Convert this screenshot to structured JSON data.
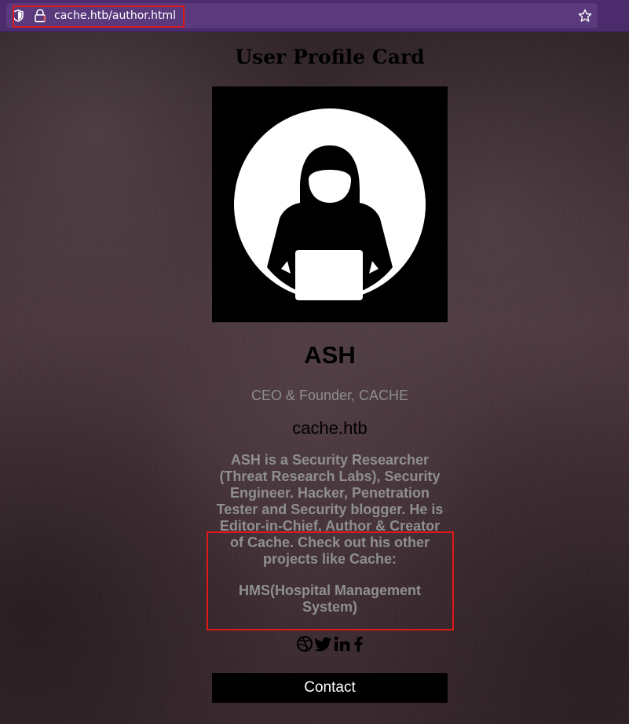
{
  "browser": {
    "url": "cache.htb/author.html"
  },
  "page": {
    "title": "User Profile Card"
  },
  "profile": {
    "name": "ASH",
    "role": "CEO & Founder, CACHE",
    "website": "cache.htb",
    "bio": "ASH is a Security Researcher (Threat Research Labs), Security Engineer. Hacker, Penetration Tester and Security blogger. He is Editor-in-Chief, Author & Creator of Cache. Check out his other projects like Cache:",
    "projects": "HMS(Hospital Management System)",
    "contact_label": "Contact"
  },
  "social": {
    "icons": [
      "dribbble-icon",
      "twitter-icon",
      "linkedin-icon",
      "facebook-icon"
    ]
  },
  "colors": {
    "browser_bar": "#4b2b6b",
    "highlight": "#e01818",
    "card_accent": "#000000",
    "muted_text": "#8d8d8d"
  }
}
